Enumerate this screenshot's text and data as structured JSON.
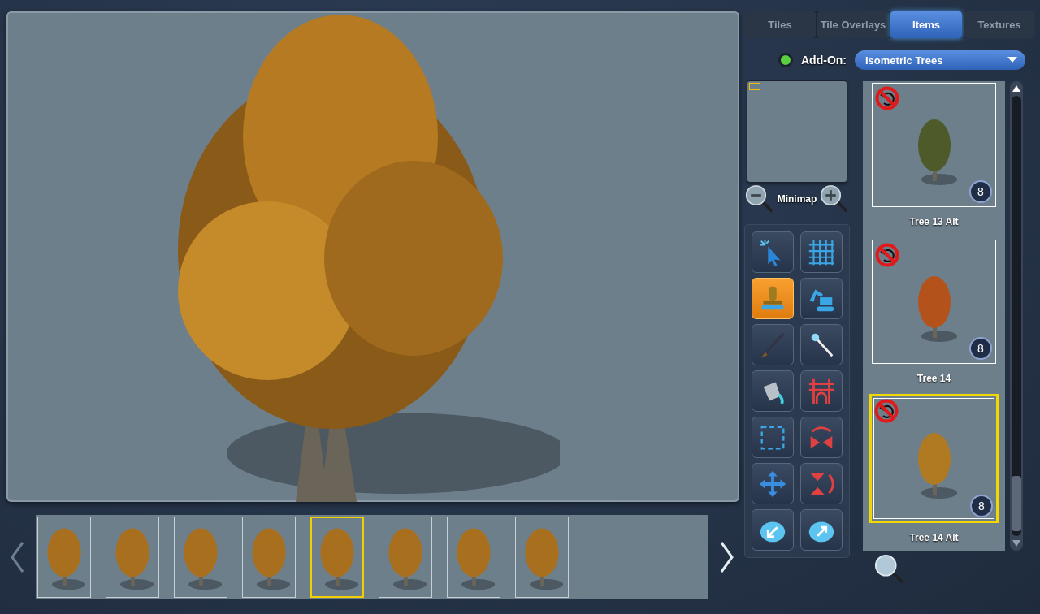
{
  "tabs": [
    {
      "label": "Tiles",
      "selected": false
    },
    {
      "label": "Tile Overlays",
      "selected": false
    },
    {
      "label": "Items",
      "selected": true
    },
    {
      "label": "Textures",
      "selected": false
    }
  ],
  "addon": {
    "label": "Add-On:",
    "on": true,
    "value": "Isometric Trees"
  },
  "minimap": {
    "label": "Minimap"
  },
  "tools": [
    {
      "kind": "select",
      "selected": false
    },
    {
      "kind": "grid",
      "selected": false
    },
    {
      "kind": "stamp",
      "selected": true
    },
    {
      "kind": "excavator",
      "selected": false
    },
    {
      "kind": "brush",
      "selected": false
    },
    {
      "kind": "wand",
      "selected": false
    },
    {
      "kind": "fill",
      "selected": false
    },
    {
      "kind": "wall",
      "selected": false
    },
    {
      "kind": "marquee",
      "selected": false
    },
    {
      "kind": "flip-h",
      "selected": false
    },
    {
      "kind": "move",
      "selected": false
    },
    {
      "kind": "flip-v",
      "selected": false
    },
    {
      "kind": "import",
      "selected": false
    },
    {
      "kind": "export",
      "selected": false
    }
  ],
  "items": [
    {
      "name": "Tree 13 Alt",
      "count": "8",
      "selected": false,
      "color": "#4e5a2a"
    },
    {
      "name": "Tree 14",
      "count": "8",
      "selected": false,
      "color": "#b4521c"
    },
    {
      "name": "Tree 14 Alt",
      "count": "8",
      "selected": true,
      "color": "#b07a22"
    }
  ],
  "frames": [
    {
      "selected": false
    },
    {
      "selected": false
    },
    {
      "selected": false
    },
    {
      "selected": false
    },
    {
      "selected": true
    },
    {
      "selected": false
    },
    {
      "selected": false
    },
    {
      "selected": false
    }
  ]
}
